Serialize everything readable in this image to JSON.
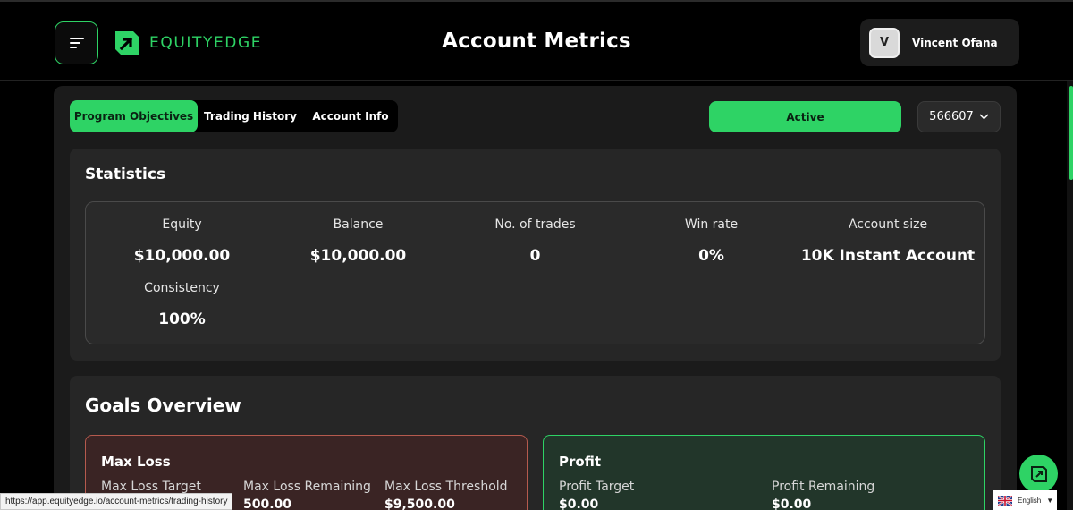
{
  "header": {
    "brand": "EQUITYEDGE",
    "title": "Account Metrics",
    "user": {
      "initial": "V",
      "name": "Vincent Ofana"
    }
  },
  "tabs": [
    {
      "label": "Program Objectives",
      "active": true
    },
    {
      "label": "Trading History",
      "active": false
    },
    {
      "label": "Account Info",
      "active": false
    }
  ],
  "status": {
    "label": "Active"
  },
  "account_select": {
    "value": "566607"
  },
  "statistics": {
    "title": "Statistics",
    "items": [
      {
        "label": "Equity",
        "value": "$10,000.00"
      },
      {
        "label": "Balance",
        "value": "$10,000.00"
      },
      {
        "label": "No. of trades",
        "value": "0"
      },
      {
        "label": "Win rate",
        "value": "0%"
      },
      {
        "label": "Account size",
        "value": "10K Instant Account"
      },
      {
        "label": "Consistency",
        "value": "100%"
      }
    ]
  },
  "goals": {
    "title": "Goals Overview",
    "max_loss": {
      "title": "Max Loss",
      "cols": [
        {
          "label": "Max Loss Target",
          "value": ""
        },
        {
          "label": "Max Loss Remaining",
          "value": "500.00"
        },
        {
          "label": "Max Loss Threshold",
          "value": "$9,500.00"
        }
      ]
    },
    "profit": {
      "title": "Profit",
      "cols": [
        {
          "label": "Profit Target",
          "value": "$0.00"
        },
        {
          "label": "Profit Remaining",
          "value": "$0.00"
        }
      ]
    }
  },
  "browser_status": {
    "url": "https://app.equityedge.io/account-metrics/trading-history"
  },
  "language": {
    "label": "English"
  },
  "colors": {
    "accent": "#2ed365",
    "loss_border": "#b55a4e",
    "panel": "#262626"
  }
}
